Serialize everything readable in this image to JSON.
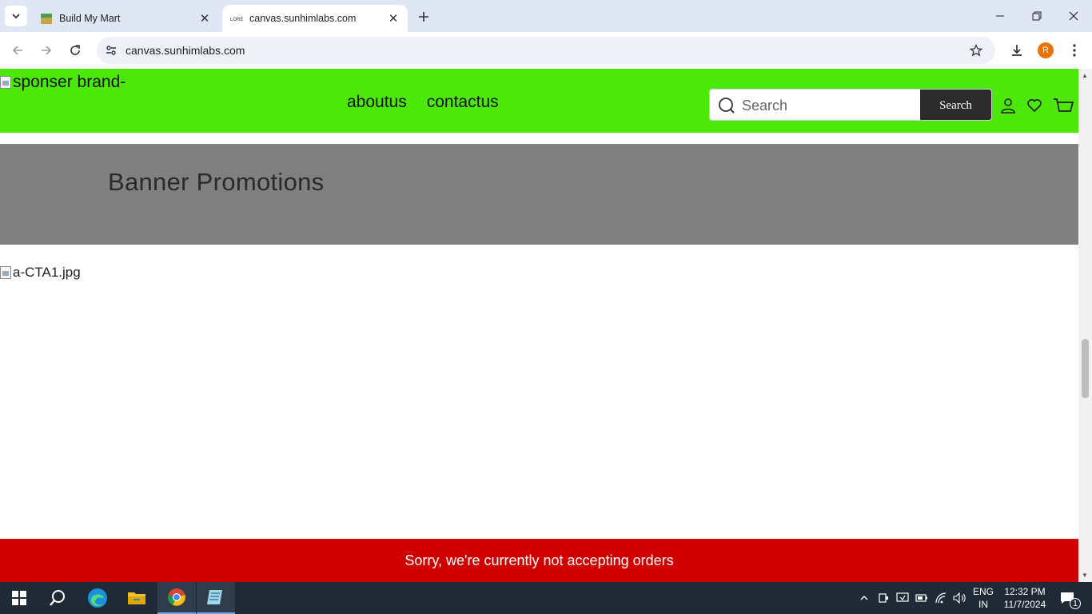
{
  "browser": {
    "tabs": [
      {
        "title": "Build My Mart",
        "active": false
      },
      {
        "title": "canvas.sunhimlabs.com",
        "active": true
      }
    ],
    "url": "canvas.sunhimlabs.com",
    "profile_initial": "R"
  },
  "header": {
    "logo_alt": "sponser brand-",
    "nav": [
      {
        "label": "aboutus"
      },
      {
        "label": "contactus"
      }
    ],
    "search": {
      "placeholder": "Search",
      "button_label": "Search"
    }
  },
  "banner": {
    "title": "Banner Promotions"
  },
  "cta_image_alt": "a-CTA1.jpg",
  "order_notice": "Sorry, we're currently not accepting orders",
  "taskbar": {
    "lang_top": "ENG",
    "lang_bottom": "IN",
    "time": "12:32 PM",
    "date": "11/7/2024",
    "notification_count": "1"
  },
  "colors": {
    "header_bg": "#4be80a",
    "banner_bg": "#808080",
    "notice_bg": "#d10000",
    "search_button_bg": "#2b2b2b"
  }
}
